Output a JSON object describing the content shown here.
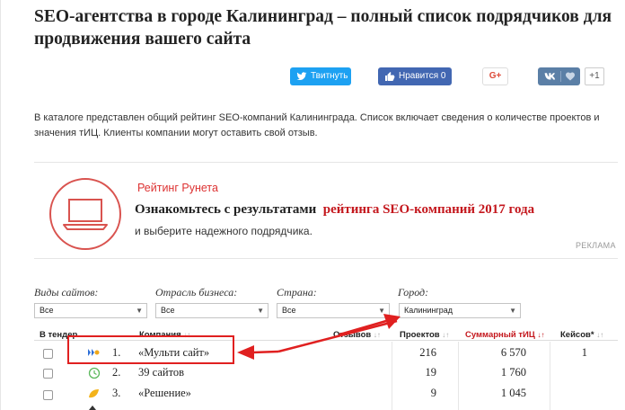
{
  "page": {
    "title": "SEO-агентства в городе Калининград – полный список подрядчиков для продвижения вашего сайта",
    "intro": "В каталоге представлен общий рейтинг SEO-компаний Калининграда. Список включает сведения о количестве проектов и значения тИЦ. Клиенты компании могут оставить свой отзыв."
  },
  "share": {
    "twitter_label": "Твитнуть",
    "facebook_label": "Нравится 0",
    "gplus_label": "G+",
    "vk_count": "+1"
  },
  "banner": {
    "brand": "Рейтинг Рунета",
    "line1_prefix": "Ознакомьтесь с результатами",
    "line1_highlight": "рейтинга SEO-компаний 2017 года",
    "line2": "и выберите надежного подрядчика.",
    "ad_label": "РЕКЛАМА"
  },
  "filters": {
    "site_types_label": "Виды сайтов:",
    "industry_label": "Отрасль бизнеса:",
    "country_label": "Страна:",
    "city_label": "Город:",
    "site_types_value": "Все",
    "industry_value": "Все",
    "country_value": "Все",
    "city_value": "Калининград"
  },
  "table": {
    "headers": {
      "tender": "В тендер",
      "company": "Компания",
      "reviews": "Отзывов",
      "projects": "Проектов",
      "tic": "Суммарный тИЦ",
      "cases": "Кейсов*"
    },
    "rows": [
      {
        "rank": "1.",
        "name": "«Мульти сайт»",
        "projects": "216",
        "tic": "6 570",
        "cases": "1"
      },
      {
        "rank": "2.",
        "name": "39 сайтов",
        "projects": "19",
        "tic": "1 760",
        "cases": ""
      },
      {
        "rank": "3.",
        "name": "«Решение»",
        "projects": "9",
        "tic": "1 045",
        "cases": ""
      }
    ]
  },
  "colors": {
    "accent_red": "#c4171d",
    "twitter": "#1da1f2",
    "facebook": "#4267b2",
    "vk": "#5b7fa6"
  }
}
